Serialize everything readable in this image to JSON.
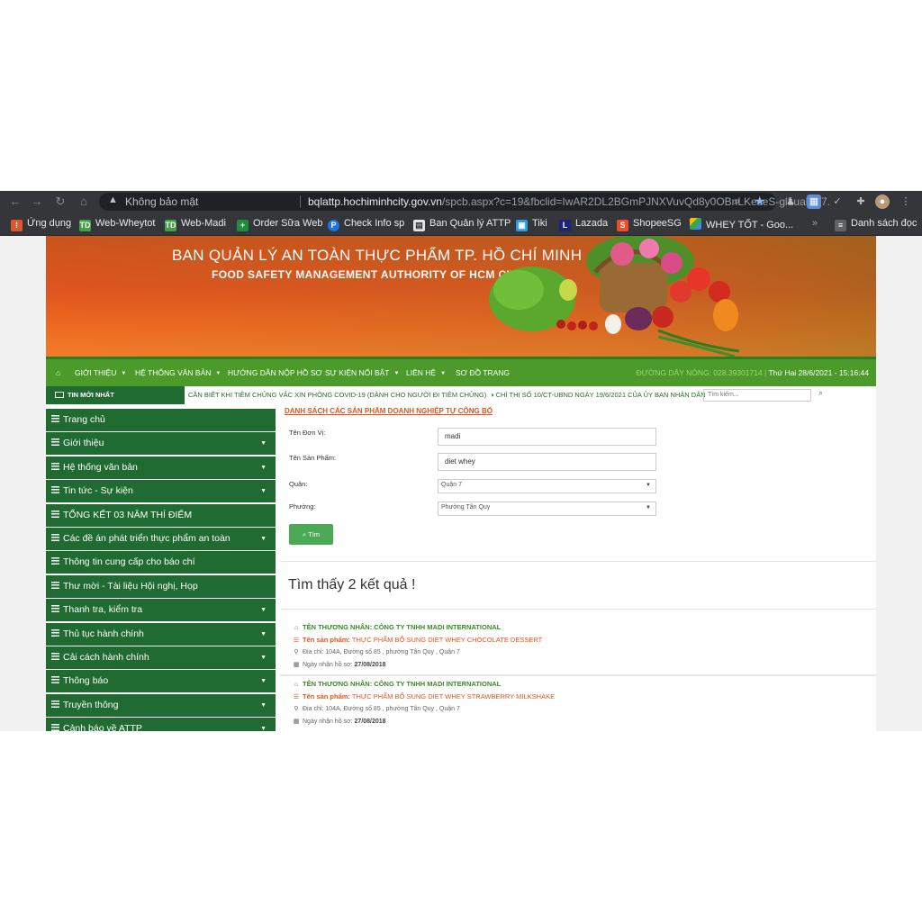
{
  "browser": {
    "security_label": "Không bảo mật",
    "url_host": "bqlattp.hochiminhcity.gov.vn",
    "url_path": "/spcb.aspx?c=19&fbclid=IwAR2DL2BGmPJNXVuvQd8y0OBnLKeceS-glLualRJ7...",
    "bookmarks": [
      "Ứng dụng",
      "Web-Wheytot",
      "Web-Madi",
      "Order Sữa Web",
      "Check Info sp",
      "Ban Quản lý ATTP",
      "Tiki",
      "Lazada",
      "ShopeeSG",
      "WHEY TỐT - Goo..."
    ],
    "bookmarks_overflow": "»",
    "reading_list": "Danh sách đọc"
  },
  "banner": {
    "title_vi": "BAN QUẢN LÝ AN TOÀN THỰC PHẨM TP. HỒ CHÍ MINH",
    "title_en": "FOOD SAFETY MANAGEMENT AUTHORITY OF HCM CITY"
  },
  "nav": {
    "items": [
      "GIỚI THIỆU",
      "HỆ THỐNG VĂN BẢN",
      "HƯỚNG DẪN NỘP HỒ SƠ",
      "SỰ KIỆN NỔI BẬT",
      "LIÊN HỆ",
      "SƠ ĐỒ TRANG"
    ],
    "hotline": "ĐƯỜNG DÂY NÓNG: 028.39301714 |",
    "datetime": "Thứ Hai 28/6/2021 - 15:16:44"
  },
  "news": {
    "label": "TIN MỚI NHẤT",
    "ticker1": "CẦN BIẾT KHI TIÊM CHỦNG VẮC XIN PHÒNG COVID-19 (DÀNH CHO NGƯỜI ĐI TIÊM CHỦNG)",
    "ticker2": "CHỈ THỊ SỐ 10/CT-UBND NGÀY 19/6/2021 CỦA ỦY BAN NHÂN DÂN",
    "search_placeholder": "Tìm kiếm..."
  },
  "sidebar": {
    "items": [
      {
        "label": "Trang chủ",
        "caret": ""
      },
      {
        "label": "Giới thiệu",
        "caret": "▼"
      },
      {
        "label": "Hệ thống văn bản",
        "caret": "▼"
      },
      {
        "label": "Tin tức - Sự kiện",
        "caret": "▼"
      },
      {
        "label": "TỔNG KẾT 03 NĂM THÍ ĐIỂM",
        "caret": ""
      },
      {
        "label": "Các đề án phát triển thực phẩm an toàn",
        "caret": "▼"
      },
      {
        "label": "Thông tin cung cấp cho báo chí",
        "caret": ""
      },
      {
        "label": "Thư mời - Tài liệu Hội nghị, Họp",
        "caret": ""
      },
      {
        "label": "Thanh tra, kiểm tra",
        "caret": "▼"
      },
      {
        "label": "Thủ tục hành chính",
        "caret": "▼"
      },
      {
        "label": "Cải cách hành chính",
        "caret": "▼"
      },
      {
        "label": "Thông báo",
        "caret": "▼"
      },
      {
        "label": "Truyền thông",
        "caret": "▼"
      },
      {
        "label": "Cảnh báo về ATTP",
        "caret": "▼"
      }
    ]
  },
  "form": {
    "heading": "DANH SÁCH CÁC SẢN PHẨM DOANH NGHIỆP TỰ CÔNG BỐ",
    "unit_label": "Tên Đơn Vị:",
    "unit_value": "madi",
    "product_label": "Tên Sản Phẩm:",
    "product_value": "diet whey",
    "district_label": "Quận:",
    "district_value": "Quận 7",
    "ward_label": "Phường:",
    "ward_value": "Phường Tân Quy",
    "find_button": "Tìm"
  },
  "results": {
    "found_text": "Tìm thấy 2 kết quả !",
    "items": [
      {
        "merchant": "TÊN THƯƠNG NHÂN: CÔNG TY TNHH MADI INTERNATIONAL",
        "product_prefix": "Tên sản phẩm:",
        "product_name": "THỰC PHẨM BỔ SUNG DIET WHEY CHOCOLATE DESSERT",
        "address": "Địa chỉ: 104A, Đường số 85 , phường Tân Quy , Quận 7",
        "date_prefix": "Ngày nhận hồ sơ:",
        "date_value": "27/08/2018"
      },
      {
        "merchant": "TÊN THƯƠNG NHÂN: CÔNG TY TNHH MADI INTERNATIONAL",
        "product_prefix": "Tên sản phẩm:",
        "product_name": "THỰC PHẨM BỔ SUNG DIET WHEY STRAWBERRY MILKSHAKE",
        "address": "Địa chỉ: 104A, Đường số 85 , phường Tân Quy , Quận 7",
        "date_prefix": "Ngày nhận hồ sơ:",
        "date_value": "27/08/2018"
      }
    ]
  },
  "colors": {
    "nav_green": "#4b9a2a",
    "sidebar_green": "#1f6b31",
    "accent_orange": "#e0551f",
    "button_green": "#4caa57"
  }
}
